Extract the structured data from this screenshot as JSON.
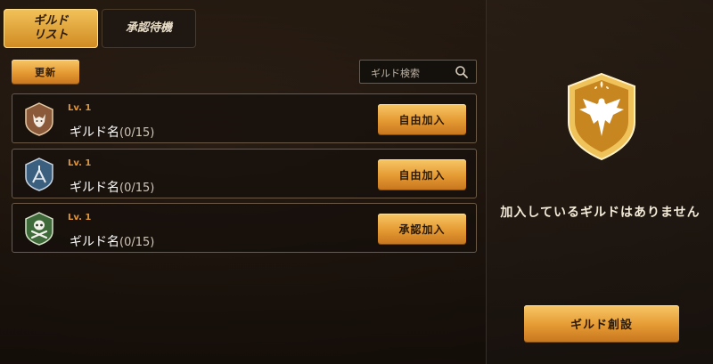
{
  "tabs": [
    {
      "label": "ギルド\nリスト",
      "active": true
    },
    {
      "label": "承認待機",
      "active": false
    }
  ],
  "toolbar": {
    "refresh_label": "更新"
  },
  "search": {
    "placeholder": "ギルド検索",
    "icon": "search-icon"
  },
  "guilds": [
    {
      "level": "Lv. 1",
      "name": "ギルド名",
      "count": "(0/15)",
      "button": "自由加入",
      "emblem": "wolf-emblem-icon",
      "emblem_color": "#8a5a3a"
    },
    {
      "level": "Lv. 1",
      "name": "ギルド名",
      "count": "(0/15)",
      "button": "自由加入",
      "emblem": "crossed-swords-emblem-icon",
      "emblem_color": "#3b5f7f"
    },
    {
      "level": "Lv. 1",
      "name": "ギルド名",
      "count": "(0/15)",
      "button": "承認加入",
      "emblem": "skull-emblem-icon",
      "emblem_color": "#3f6b3a"
    }
  ],
  "right_panel": {
    "emblem": "eagle-crest-icon",
    "message": "加入しているギルドはありません",
    "create_label": "ギルド創設"
  },
  "colors": {
    "accent": "#e8a23a",
    "level": "#e0953a"
  }
}
